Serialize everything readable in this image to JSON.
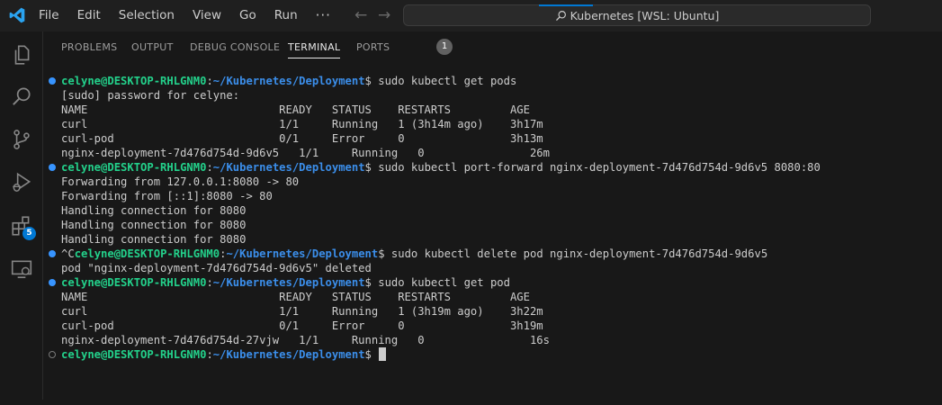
{
  "titlebar": {
    "menu": [
      "File",
      "Edit",
      "Selection",
      "View",
      "Go",
      "Run",
      "···"
    ],
    "search_text": "Kubernetes [WSL: Ubuntu]",
    "back_arrow": "←",
    "forward_arrow": "→"
  },
  "activitybar": {
    "icons": [
      "explorer-icon",
      "search-icon",
      "source-control-icon",
      "run-debug-icon",
      "extensions-icon",
      "remote-explorer-icon"
    ],
    "extensions_badge": "5"
  },
  "panel": {
    "tabs": [
      "PROBLEMS",
      "OUTPUT",
      "DEBUG CONSOLE",
      "TERMINAL",
      "PORTS"
    ],
    "active_tab": "TERMINAL",
    "ports_count": "1"
  },
  "terminal": {
    "user": "celyne@DESKTOP-RHLGNM0",
    "colon": ":",
    "path": "~/Kubernetes/Deployment",
    "dollar": "$",
    "prompts": [
      {
        "prefix": "",
        "command": " sudo kubectl get pods"
      },
      {
        "prefix": "",
        "command": " sudo kubectl port-forward nginx-deployment-7d476d754d-9d6v5 8080:80"
      },
      {
        "prefix": "^C",
        "command": " sudo kubectl delete pod nginx-deployment-7d476d754d-9d6v5"
      },
      {
        "prefix": "",
        "command": " sudo kubectl get pod"
      },
      {
        "prefix": "",
        "command": ""
      }
    ],
    "output": [
      "[sudo] password for celyne:",
      "NAME                             READY   STATUS    RESTARTS         AGE",
      "curl                             1/1     Running   1 (3h14m ago)    3h17m",
      "curl-pod                         0/1     Error     0                3h13m",
      "nginx-deployment-7d476d754d-9d6v5   1/1     Running   0                26m",
      "Forwarding from 127.0.0.1:8080 -> 80",
      "Forwarding from [::1]:8080 -> 80",
      "Handling connection for 8080",
      "Handling connection for 8080",
      "Handling connection for 8080",
      "pod \"nginx-deployment-7d476d754d-9d6v5\" deleted",
      "NAME                             READY   STATUS    RESTARTS         AGE",
      "curl                             1/1     Running   1 (3h19m ago)    3h22m",
      "curl-pod                         0/1     Error     0                3h19m",
      "nginx-deployment-7d476d754d-27vjw   1/1     Running   0                16s"
    ]
  },
  "colors": {
    "accent": "#0078d4",
    "prompt_user": "#23d18b",
    "prompt_path": "#3b8eea",
    "background": "#181818"
  }
}
